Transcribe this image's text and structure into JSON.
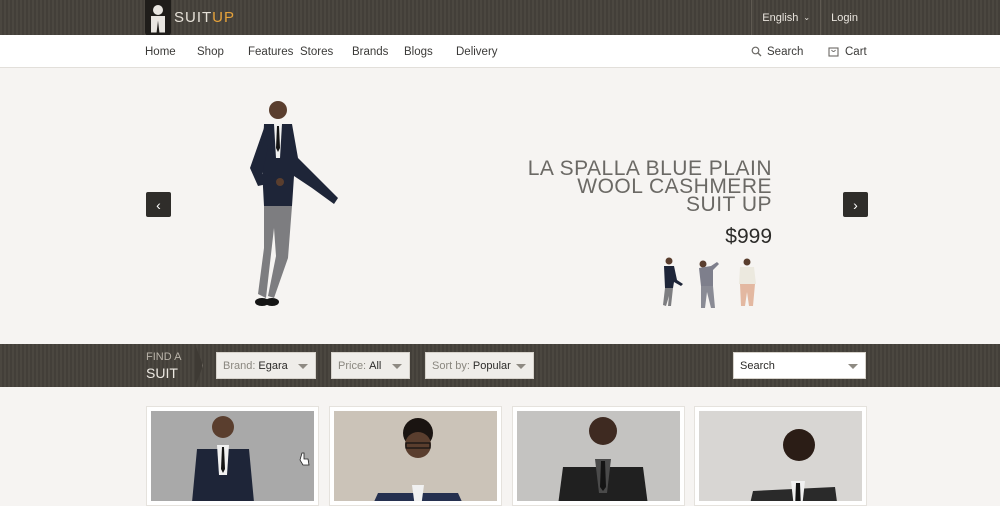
{
  "brand": {
    "name_main": "SUIT",
    "name_accent": "UP"
  },
  "topbar": {
    "language": "English",
    "login": "Login"
  },
  "nav": {
    "items": [
      "Home",
      "Shop",
      "Features",
      "Stores",
      "Brands",
      "Blogs",
      "Delivery"
    ],
    "search": "Search",
    "cart": "Cart"
  },
  "hero": {
    "title_line1": "LA SPALLA BLUE PLAIN",
    "title_line2": "WOOL CASHMERE",
    "title_line3": "SUIT UP",
    "price": "$999"
  },
  "finder": {
    "label_small": "FIND A",
    "label_big": "SUIT",
    "brand_label": "Brand:",
    "brand_value": "Egara",
    "price_label": "Price:",
    "price_value": "All",
    "sort_label": "Sort by:",
    "sort_value": "Popular",
    "search_value": "Search"
  },
  "colors": {
    "accent": "#e6a23a",
    "dark_bar": "#46423c",
    "hero_bg": "#f6f4f2"
  }
}
